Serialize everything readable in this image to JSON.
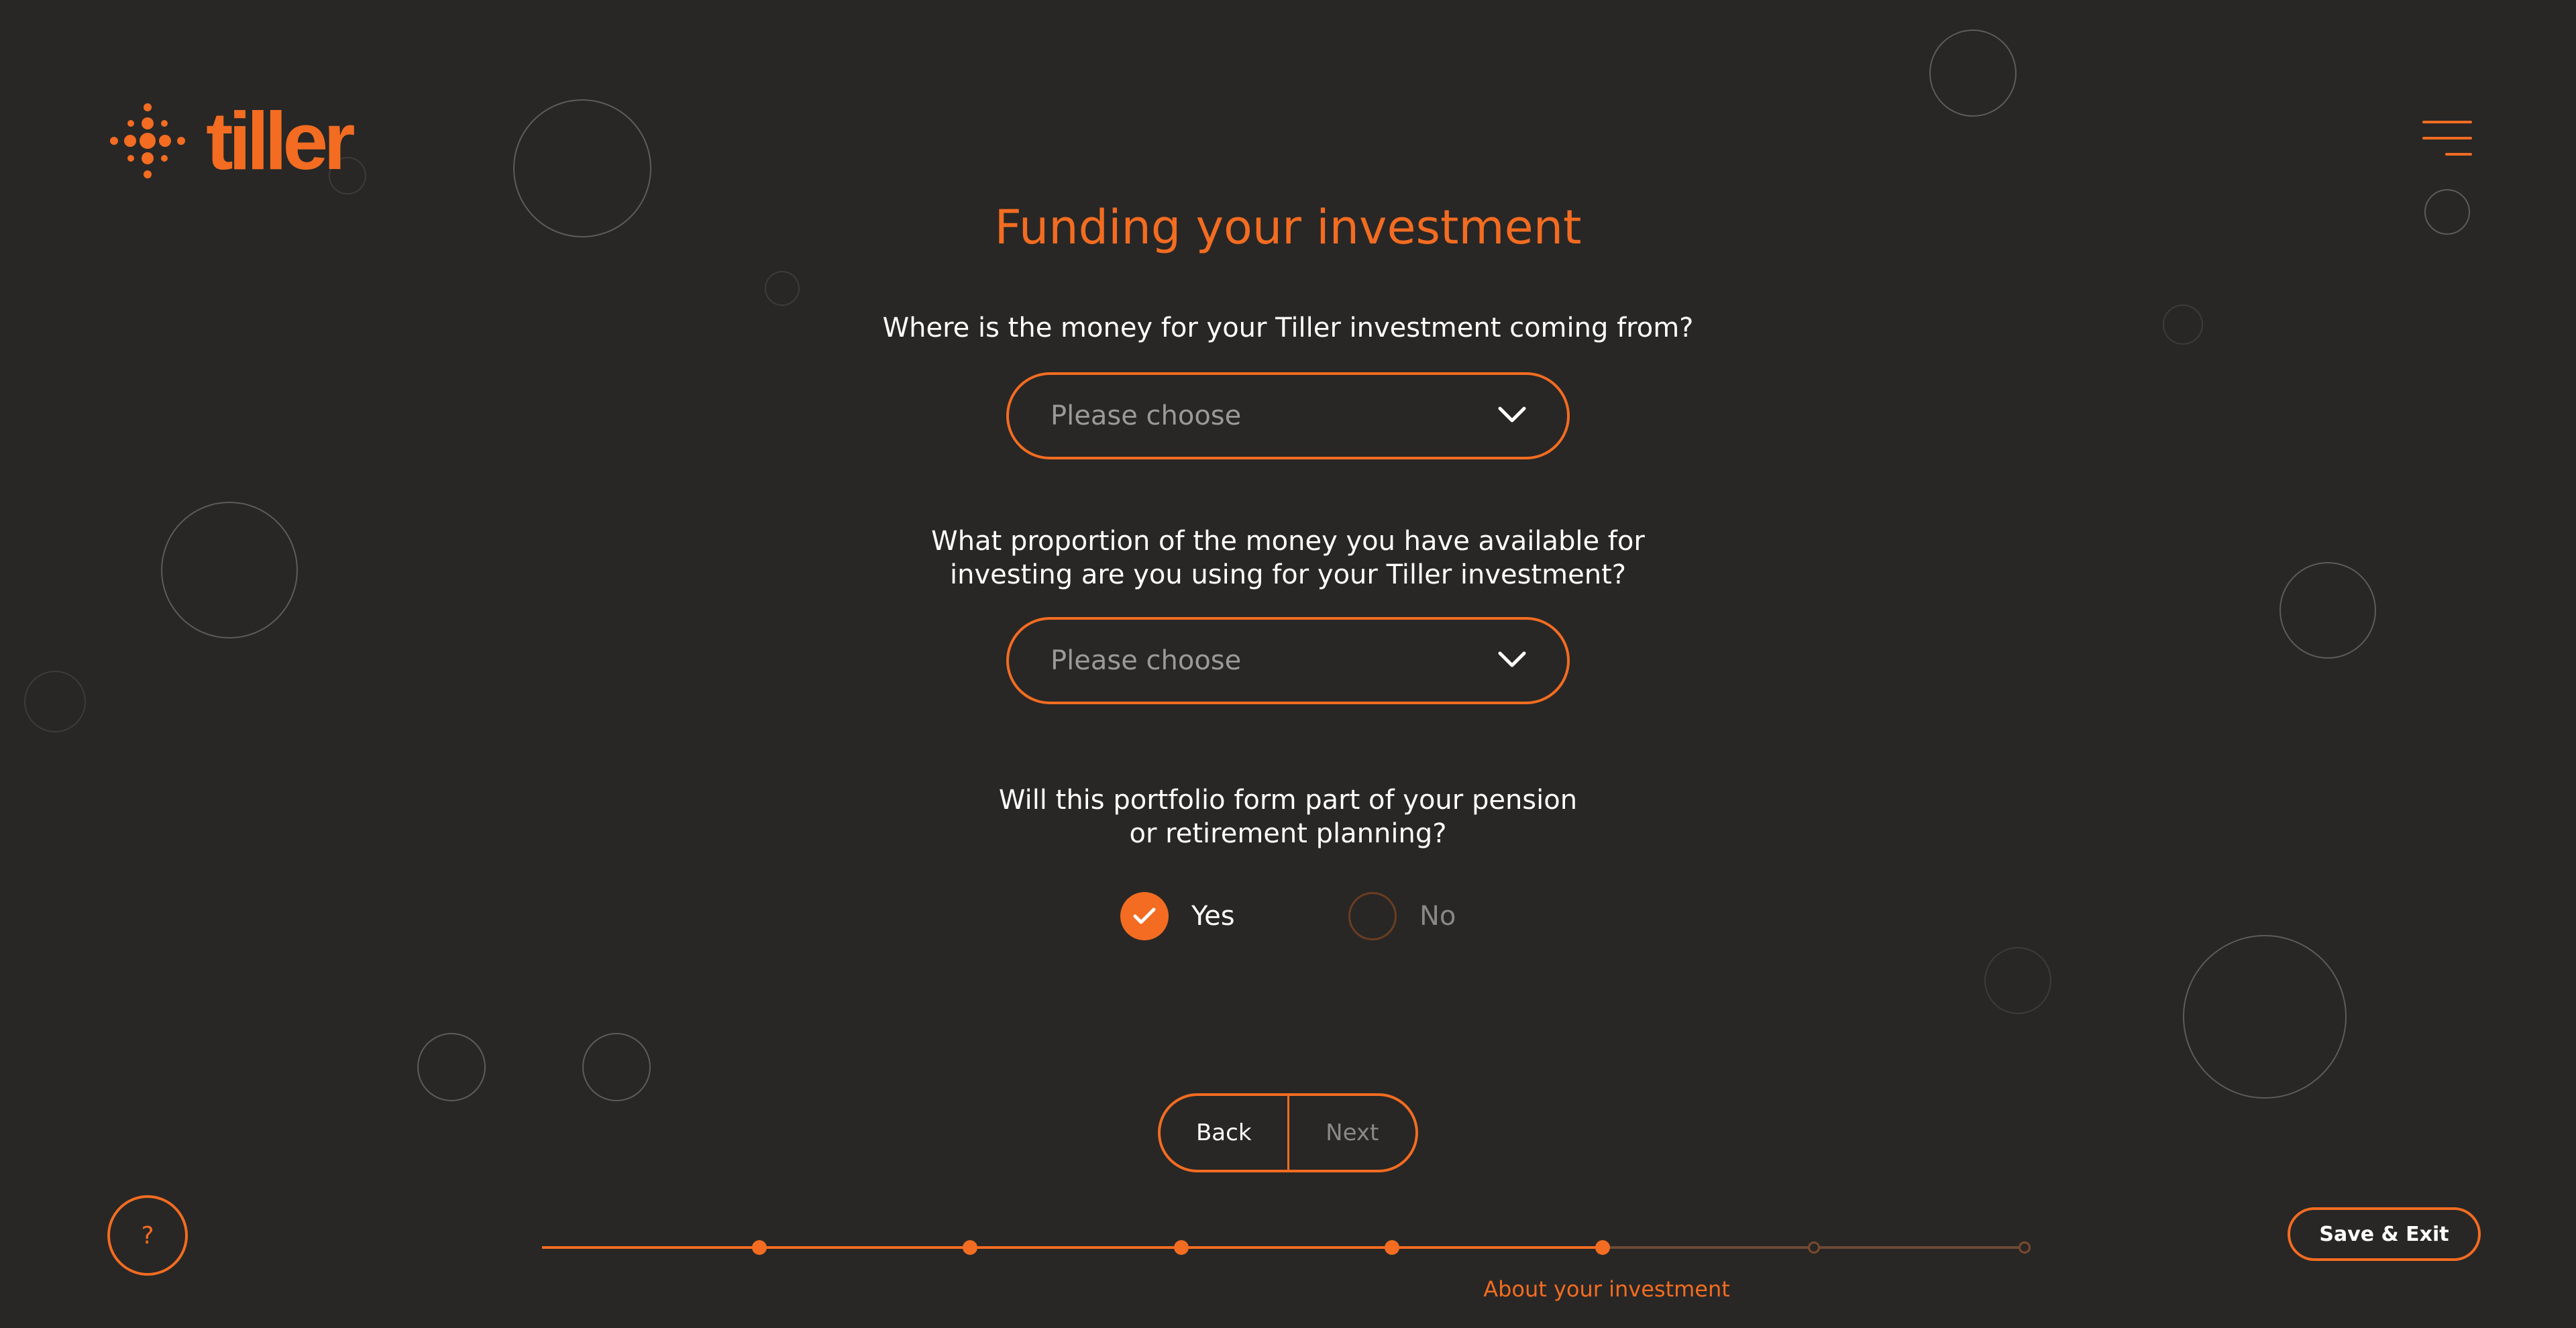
{
  "brand": {
    "name": "tiller",
    "accent_color": "#f36c21",
    "background_color": "#282726"
  },
  "header": {
    "menu_icon": "hamburger-menu-icon"
  },
  "main": {
    "title": "Funding your investment",
    "q1": {
      "text": "Where is the money for your Tiller investment coming from?",
      "placeholder": "Please choose"
    },
    "q2": {
      "line1": "What proportion of the money you have available for",
      "line2": "investing are you using for your Tiller investment?",
      "placeholder": "Please choose"
    },
    "q3": {
      "line1": "Will this portfolio form part of your pension",
      "line2": "or retirement planning?",
      "options": [
        {
          "label": "Yes",
          "selected": true
        },
        {
          "label": "No",
          "selected": false
        }
      ]
    }
  },
  "nav": {
    "back_label": "Back",
    "next_label": "Next"
  },
  "footer": {
    "help_label": "?",
    "save_exit_label": "Save & Exit",
    "progress": {
      "total_steps": 7,
      "completed_steps": 5,
      "current_label": "About your investment"
    }
  }
}
